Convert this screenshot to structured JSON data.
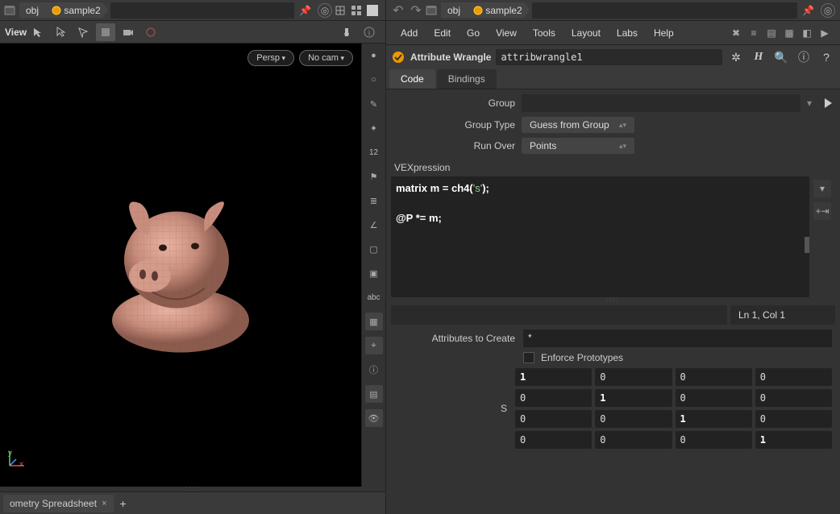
{
  "left": {
    "path_seg1": "obj",
    "path_seg2": "sample2",
    "view_label": "View",
    "persp_pill": "Persp",
    "cam_pill": "No cam",
    "toolbar_abc": "abc",
    "toolbar_12": "12",
    "spreadsheet_tab": "ometry Spreadsheet"
  },
  "right": {
    "path_seg1": "obj",
    "path_seg2": "sample2",
    "menu": {
      "add": "Add",
      "edit": "Edit",
      "go": "Go",
      "view": "View",
      "tools": "Tools",
      "layout": "Layout",
      "labs": "Labs",
      "help": "Help"
    },
    "node_type": "Attribute Wrangle",
    "node_name": "attribwrangle1",
    "tabs": {
      "code": "Code",
      "bindings": "Bindings"
    },
    "params": {
      "group_label": "Group",
      "grouptype_label": "Group Type",
      "grouptype_value": "Guess from Group",
      "runover_label": "Run Over",
      "runover_value": "Points",
      "vex_label": "VEXpression"
    },
    "code": {
      "line1_a": "matrix m = ch4(",
      "line1_b": "'s'",
      "line1_c": ");",
      "line3": "@P *= m;"
    },
    "status_lncol": "Ln 1, Col 1",
    "attrs": {
      "create_label": "Attributes to Create",
      "create_value": "*",
      "enforce_label": "Enforce Prototypes",
      "matrix_label": "S",
      "matrix": [
        [
          "1",
          "0",
          "0",
          "0"
        ],
        [
          "0",
          "1",
          "0",
          "0"
        ],
        [
          "0",
          "0",
          "1",
          "0"
        ],
        [
          "0",
          "0",
          "0",
          "1"
        ]
      ]
    }
  }
}
